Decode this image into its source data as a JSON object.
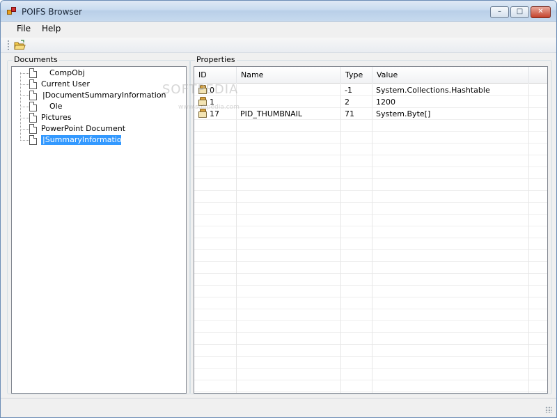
{
  "window": {
    "title": "POIFS Browser"
  },
  "menu": {
    "file": "File",
    "help": "Help"
  },
  "groups": {
    "documents": "Documents",
    "properties": "Properties"
  },
  "tree": {
    "items": [
      {
        "label": "CompObj",
        "selected": false
      },
      {
        "label": "Current User",
        "selected": false
      },
      {
        "label": "|DocumentSummaryInformation",
        "selected": false
      },
      {
        "label": "Ole",
        "selected": false
      },
      {
        "label": "Pictures",
        "selected": false
      },
      {
        "label": "PowerPoint Document",
        "selected": false
      },
      {
        "label": "|SummaryInformation",
        "selected": true
      }
    ]
  },
  "table": {
    "headers": [
      "ID",
      "Name",
      "Type",
      "Value"
    ],
    "rows": [
      {
        "id": "0",
        "name": "",
        "type": "-1",
        "value": "System.Collections.Hashtable"
      },
      {
        "id": "1",
        "name": "",
        "type": "2",
        "value": "1200"
      },
      {
        "id": "17",
        "name": "PID_THUMBNAIL",
        "type": "71",
        "value": "System.Byte[]"
      }
    ]
  },
  "watermark": {
    "text": "SOFTPEDIA",
    "sub": "www.softpedia.com"
  },
  "colors": {
    "selection": "#3399ff",
    "titlebar": "#c9dbef"
  }
}
